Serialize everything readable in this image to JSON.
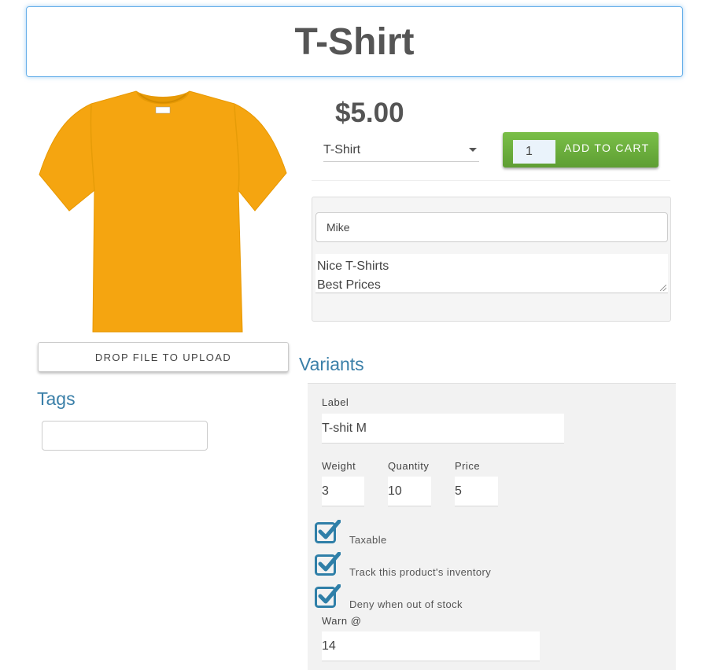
{
  "product": {
    "title": "T-Shirt",
    "image_alt": "Orange t-shirt",
    "image_color": "#f5a510",
    "price": "$5.00"
  },
  "upload": {
    "label": "DROP FILE TO UPLOAD"
  },
  "tags": {
    "heading": "Tags",
    "input_value": ""
  },
  "purchase": {
    "variant_selected": "T-Shirt",
    "quantity": "1",
    "add_to_cart_label": "ADD TO CART",
    "button_color": "#6aae3d"
  },
  "comment": {
    "name": "Mike",
    "message_line1": "Nice T-Shirts",
    "message_line2": "Best Prices"
  },
  "variants": {
    "heading": "Variants",
    "label_caption": "Label",
    "label_value": "T-shit M",
    "weight_caption": "Weight",
    "weight_value": "3",
    "quantity_caption": "Quantity",
    "quantity_value": "10",
    "price_caption": "Price",
    "price_value": "5",
    "checkboxes": [
      {
        "label": "Taxable",
        "checked": true
      },
      {
        "label": "Track this product's inventory",
        "checked": true
      },
      {
        "label": "Deny when out of stock",
        "checked": true
      }
    ],
    "warn_caption": "Warn @",
    "warn_value": "14",
    "accent_color": "#2f7fa8"
  }
}
